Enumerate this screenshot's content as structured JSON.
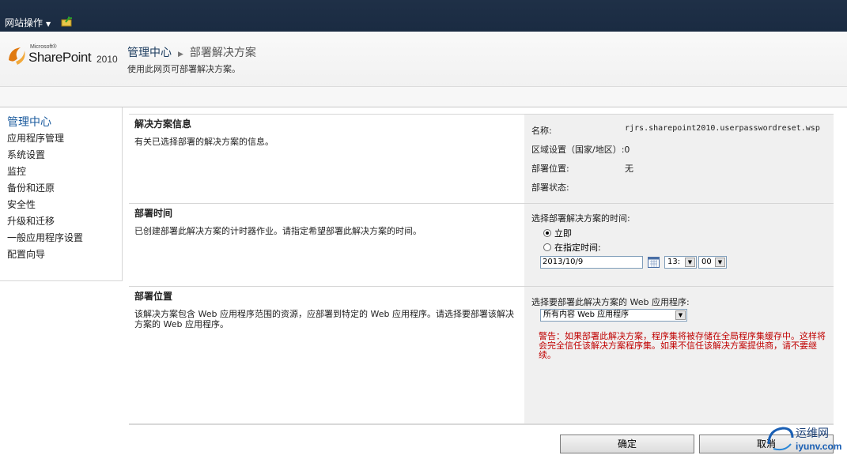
{
  "topbar": {
    "site_actions": "网站操作"
  },
  "header": {
    "logo": {
      "microsoft": "Microsoft®",
      "product": "SharePoint",
      "year": "2010"
    },
    "breadcrumb_home": "管理中心",
    "breadcrumb_current": "部署解决方案",
    "description": "使用此网页可部署解决方案。"
  },
  "leftnav": {
    "heading": "管理中心",
    "items": [
      "应用程序管理",
      "系统设置",
      "监控",
      "备份和还原",
      "安全性",
      "升级和迁移",
      "一般应用程序设置",
      "配置向导"
    ]
  },
  "sections": {
    "info": {
      "title": "解决方案信息",
      "desc": "有关已选择部署的解决方案的信息。",
      "name_label": "名称:",
      "name_value": "rjrs.sharepoint2010.userpasswordreset.wsp",
      "locale_label": "区域设置（国家/地区）:",
      "locale_value": "0",
      "location_label": "部署位置:",
      "location_value": "无",
      "status_label": "部署状态:"
    },
    "time": {
      "title": "部署时间",
      "desc": "已创建部署此解决方案的计时器作业。请指定希望部署此解决方案的时间。",
      "prompt": "选择部署解决方案的时间:",
      "now_label": "立即",
      "specified_label": "在指定时间:",
      "date_value": "2013/10/9",
      "hour_value": "13:",
      "minute_value": "00"
    },
    "location": {
      "title": "部署位置",
      "desc": "该解决方案包含 Web 应用程序范围的资源，应部署到特定的 Web 应用程序。请选择要部署该解决方案的 Web 应用程序。",
      "prompt": "选择要部署此解决方案的 Web 应用程序:",
      "select_value": "所有内容 Web 应用程序",
      "warning": "警告：如果部署此解决方案，程序集将被存储在全局程序集缓存中。这样将会完全信任该解决方案程序集。如果不信任该解决方案提供商，请不要继续。"
    }
  },
  "buttons": {
    "ok": "确定",
    "cancel": "取消"
  },
  "watermark": {
    "cn": "运维网",
    "url": "iyunv.com"
  }
}
